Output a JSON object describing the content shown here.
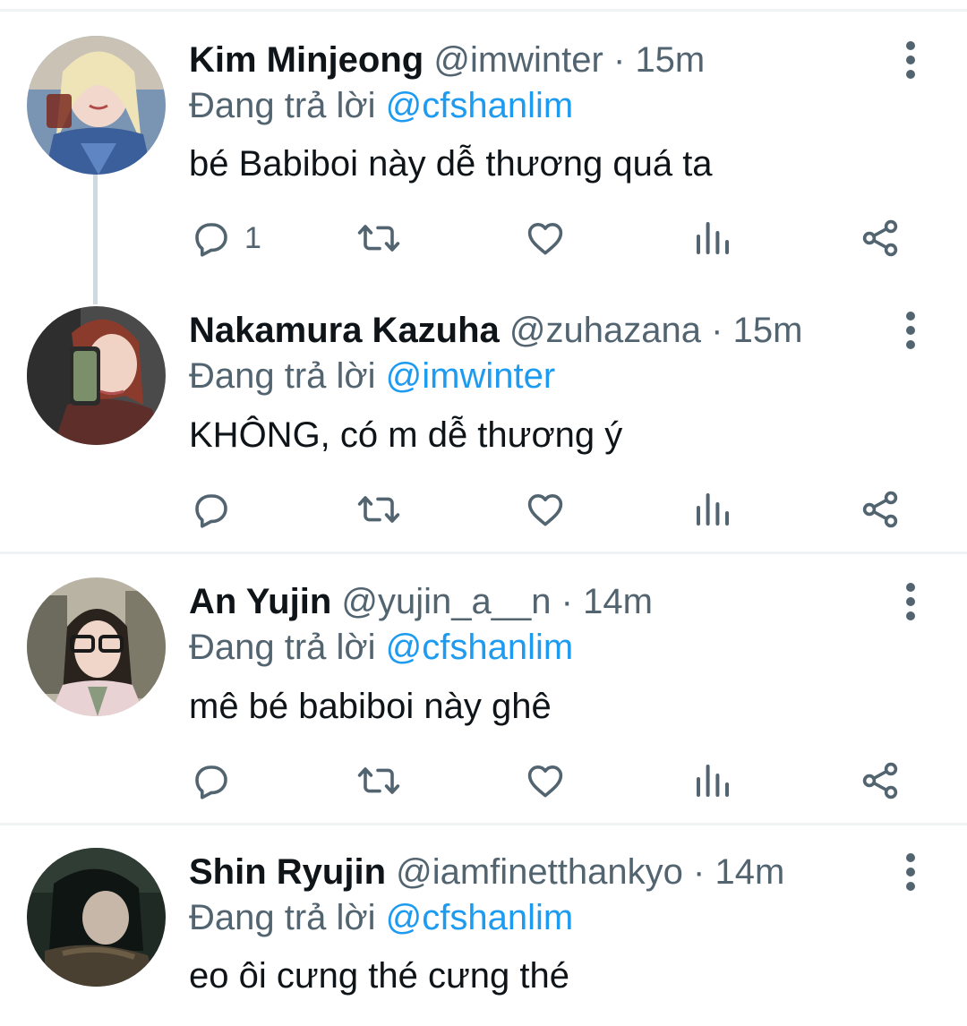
{
  "reply_prefix": "Đang trả lời",
  "tweets": [
    {
      "name": "Kim Minjeong",
      "handle": "@imwinter",
      "sep": "·",
      "time": "15m",
      "reply_to": "@cfshanlim",
      "text": "bé Babiboi này dễ thương quá ta",
      "reply_count": "1",
      "avatar_icon": "avatar-photo-icon"
    },
    {
      "name": "Nakamura Kazuha",
      "handle": "@zuhazana",
      "sep": "·",
      "time": "15m",
      "reply_to": "@imwinter",
      "text": "KHÔNG, có m dễ thương ý",
      "reply_count": "",
      "avatar_icon": "avatar-photo-icon"
    },
    {
      "name": "An Yujin",
      "handle": "@yujin_a__n",
      "sep": "·",
      "time": "14m",
      "reply_to": "@cfshanlim",
      "text": "mê bé babiboi này ghê",
      "reply_count": "",
      "avatar_icon": "avatar-photo-icon"
    },
    {
      "name": "Shin Ryujin",
      "handle": "@iamfinetthankyo",
      "sep": "·",
      "time": "14m",
      "reply_to": "@cfshanlim",
      "text": "eo ôi cưng thé cưng thé",
      "reply_count": "",
      "avatar_icon": "avatar-photo-icon"
    }
  ],
  "colors": {
    "accent": "#1d9bf0",
    "icon": "#536471",
    "divider": "#eff3f4",
    "thread_line": "#cfd9de"
  },
  "icons": [
    "reply-icon",
    "retweet-icon",
    "like-icon",
    "views-icon",
    "share-icon",
    "more-icon"
  ]
}
